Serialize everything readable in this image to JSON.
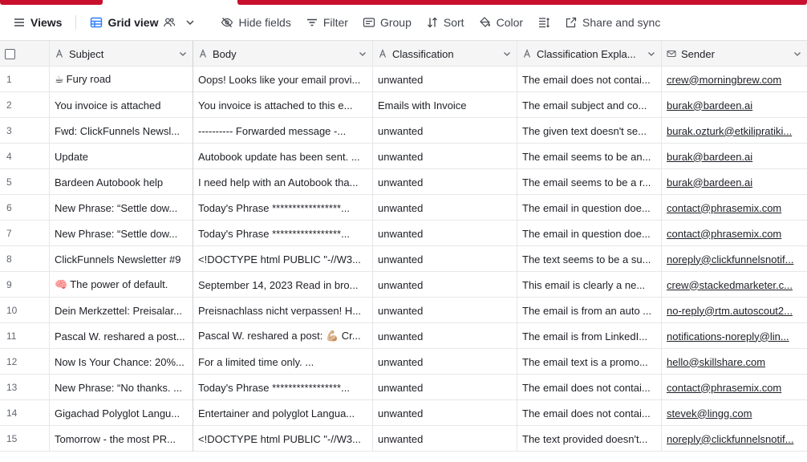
{
  "toolbar": {
    "views_label": "Views",
    "grid_view_label": "Grid view",
    "hide_fields_label": "Hide fields",
    "filter_label": "Filter",
    "group_label": "Group",
    "sort_label": "Sort",
    "color_label": "Color",
    "share_label": "Share and sync"
  },
  "columns": {
    "subject": "Subject",
    "body": "Body",
    "classification": "Classification",
    "explanation": "Classification Expla...",
    "sender": "Sender"
  },
  "rows": [
    {
      "num": "1",
      "emoji": "☕",
      "subject": "Fury road",
      "body": "Oops! Looks like your email provi...",
      "classification": "unwanted",
      "explanation": "The email does not contai...",
      "sender": "crew@morningbrew.com"
    },
    {
      "num": "2",
      "emoji": "",
      "subject": "You invoice is attached",
      "body": "You invoice is attached to this e...",
      "classification": "Emails with Invoice",
      "explanation": "The email subject and co...",
      "sender": "burak@bardeen.ai"
    },
    {
      "num": "3",
      "emoji": "",
      "subject": "Fwd: ClickFunnels Newsl...",
      "body": "---------- Forwarded message -...",
      "classification": "unwanted",
      "explanation": "The given text doesn't se...",
      "sender": "burak.ozturk@etkilipratiki..."
    },
    {
      "num": "4",
      "emoji": "",
      "subject": "Update",
      "body": "Autobook update has been sent. ...",
      "classification": "unwanted",
      "explanation": "The email seems to be an...",
      "sender": "burak@bardeen.ai"
    },
    {
      "num": "5",
      "emoji": "",
      "subject": "Bardeen Autobook help",
      "body": "I need help with an Autobook tha...",
      "classification": "unwanted",
      "explanation": "The email seems to be a r...",
      "sender": "burak@bardeen.ai"
    },
    {
      "num": "6",
      "emoji": "",
      "subject": "New Phrase: “Settle dow...",
      "body": "Today's Phrase *****************...",
      "classification": "unwanted",
      "explanation": "The email in question doe...",
      "sender": "contact@phrasemix.com"
    },
    {
      "num": "7",
      "emoji": "",
      "subject": "New Phrase: “Settle dow...",
      "body": "Today's Phrase *****************...",
      "classification": "unwanted",
      "explanation": "The email in question doe...",
      "sender": "contact@phrasemix.com"
    },
    {
      "num": "8",
      "emoji": "",
      "subject": "ClickFunnels Newsletter #9",
      "body": "<!DOCTYPE html PUBLIC \"-//W3...",
      "classification": "unwanted",
      "explanation": "The text seems to be a su...",
      "sender": "noreply@clickfunnelsnotif..."
    },
    {
      "num": "9",
      "emoji": "🧠",
      "subject": "The power of default.",
      "body": "September 14, 2023 Read in bro...",
      "classification": "unwanted",
      "explanation": "This email is clearly a ne...",
      "sender": "crew@stackedmarketer.c..."
    },
    {
      "num": "10",
      "emoji": "",
      "subject": "Dein Merkzettel: Preisalar...",
      "body": "Preisnachlass nicht verpassen! H...",
      "classification": "unwanted",
      "explanation": "The email is from an auto ...",
      "sender": "no-reply@rtm.autoscout2..."
    },
    {
      "num": "11",
      "emoji": "",
      "subject": "Pascal W. reshared a post...",
      "body": "Pascal W. reshared a post: 💪🏼 Cr...",
      "classification": "unwanted",
      "explanation": "The email is from LinkedI...",
      "sender": "notifications-noreply@lin..."
    },
    {
      "num": "12",
      "emoji": "",
      "subject": "Now Is Your Chance: 20%...",
      "body": "For a limited time only.          ...",
      "classification": "unwanted",
      "explanation": "The email text is a promo...",
      "sender": "hello@skillshare.com"
    },
    {
      "num": "13",
      "emoji": "",
      "subject": "New Phrase: “No thanks. ...",
      "body": "Today's Phrase *****************...",
      "classification": "unwanted",
      "explanation": "The email does not contai...",
      "sender": "contact@phrasemix.com"
    },
    {
      "num": "14",
      "emoji": "",
      "subject": "Gigachad Polyglot Langu...",
      "body": "Entertainer and polyglot Langua...",
      "classification": "unwanted",
      "explanation": "The email does not contai...",
      "sender": "stevek@lingg.com"
    },
    {
      "num": "15",
      "emoji": "",
      "subject": "Tomorrow - the most PR...",
      "body": "<!DOCTYPE html PUBLIC \"-//W3...",
      "classification": "unwanted",
      "explanation": "The text provided doesn't...",
      "sender": "noreply@clickfunnelsnotif..."
    }
  ],
  "colors": {
    "accent": "#c8102e",
    "header_bg": "#f5f5f5",
    "border": "#e6e7ea"
  },
  "icons": {
    "views": "hamburger-icon",
    "grid": "grid-icon",
    "collaborators": "people-icon",
    "hide": "eye-slash-icon",
    "filter": "filter-icon",
    "group": "group-icon",
    "sort": "sort-icon",
    "color": "paint-bucket-icon",
    "row_height": "row-height-icon",
    "share": "share-icon",
    "text_field": "text-field-icon",
    "email_field": "envelope-icon"
  }
}
